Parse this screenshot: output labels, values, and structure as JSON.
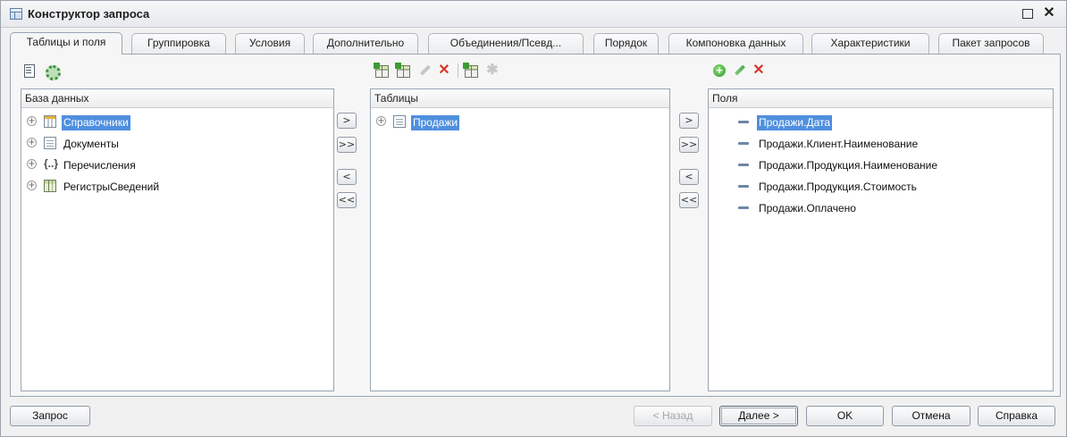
{
  "window": {
    "title": "Конструктор запроса"
  },
  "tabs": [
    {
      "label": "Таблицы и поля",
      "active": true
    },
    {
      "label": "Группировка"
    },
    {
      "label": "Условия"
    },
    {
      "label": "Дополнительно"
    },
    {
      "label": "Объединения/Псевд..."
    },
    {
      "label": "Порядок"
    },
    {
      "label": "Компоновка данных"
    },
    {
      "label": "Характеристики"
    },
    {
      "label": "Пакет запросов"
    }
  ],
  "panels": {
    "database": {
      "header": "База данных",
      "items": [
        {
          "label": "Справочники",
          "icon": "catalog-icon",
          "selected": true
        },
        {
          "label": "Документы",
          "icon": "document-icon"
        },
        {
          "label": "Перечисления",
          "icon": "enum-icon"
        },
        {
          "label": "РегистрыСведений",
          "icon": "register-icon"
        }
      ]
    },
    "tables": {
      "header": "Таблицы",
      "items": [
        {
          "label": "Продажи",
          "icon": "table-icon",
          "selected": true
        }
      ]
    },
    "fields": {
      "header": "Поля",
      "items": [
        {
          "label": "Продажи.Дата",
          "selected": true
        },
        {
          "label": "Продажи.Клиент.Наименование"
        },
        {
          "label": "Продажи.Продукция.Наименование"
        },
        {
          "label": "Продажи.Продукция.Стоимость"
        },
        {
          "label": "Продажи.Оплачено"
        }
      ]
    }
  },
  "move_buttons": {
    "add": ">",
    "add_all": ">>",
    "remove": "<",
    "remove_all": "<<"
  },
  "buttons": {
    "query": "Запрос",
    "back": "< Назад",
    "next": "Далее >",
    "ok": "OK",
    "cancel": "Отмена",
    "help": "Справка"
  },
  "colors": {
    "selection": "#4f8fdf",
    "delete": "#d9342b",
    "add": "#3c9b32"
  }
}
